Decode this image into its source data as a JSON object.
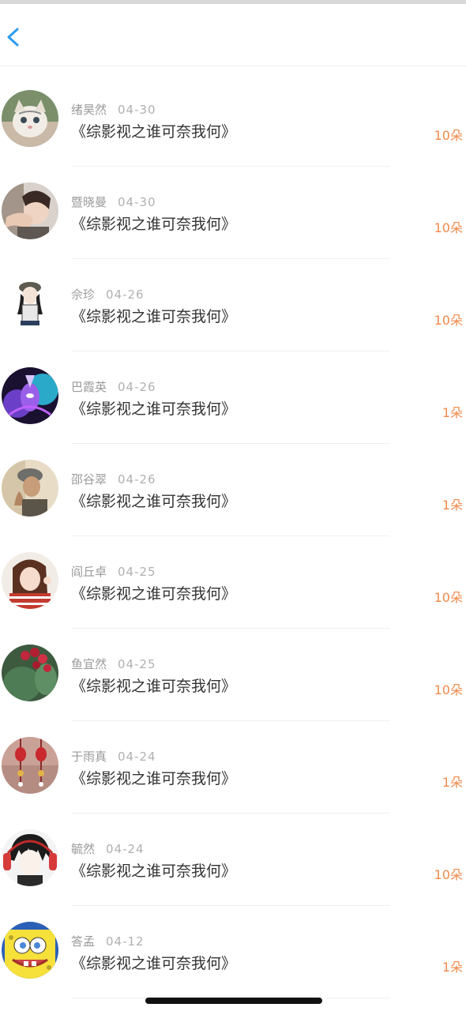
{
  "header": {
    "back_icon": "chevron-left-icon"
  },
  "items": [
    {
      "name": "绪昊然",
      "date": "04-30",
      "title": "《综影视之谁可奈我何》",
      "amount": "10朵",
      "avatar": "cat-photo"
    },
    {
      "name": "暨晓曼",
      "date": "04-30",
      "title": "《综影视之谁可奈我何》",
      "amount": "10朵",
      "avatar": "person-photo"
    },
    {
      "name": "佘珍",
      "date": "04-26",
      "title": "《综影视之谁可奈我何》",
      "amount": "10朵",
      "avatar": "cartoon-girl"
    },
    {
      "name": "巴霞英",
      "date": "04-26",
      "title": "《综影视之谁可奈我何》",
      "amount": "1朵",
      "avatar": "purple-art"
    },
    {
      "name": "邵谷翠",
      "date": "04-26",
      "title": "《综影视之谁可奈我何》",
      "amount": "1朵",
      "avatar": "cap-person"
    },
    {
      "name": "阎丘卓",
      "date": "04-25",
      "title": "《综影视之谁可奈我何》",
      "amount": "10朵",
      "avatar": "girl-photo"
    },
    {
      "name": "鱼宜然",
      "date": "04-25",
      "title": "《综影视之谁可奈我何》",
      "amount": "10朵",
      "avatar": "cactus-photo"
    },
    {
      "name": "于雨真",
      "date": "04-24",
      "title": "《综影视之谁可奈我何》",
      "amount": "1朵",
      "avatar": "ornaments-photo"
    },
    {
      "name": "毓然",
      "date": "04-24",
      "title": "《综影视之谁可奈我何》",
      "amount": "10朵",
      "avatar": "anime-boy"
    },
    {
      "name": "答孟",
      "date": "04-12",
      "title": "《综影视之谁可奈我何》",
      "amount": "1朵",
      "avatar": "spongebob"
    }
  ],
  "colors": {
    "accent": "#f08a4b",
    "back": "#2d9bf0"
  }
}
